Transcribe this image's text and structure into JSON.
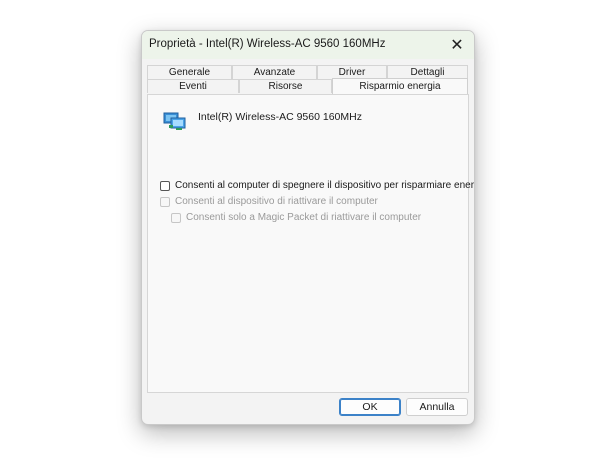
{
  "window": {
    "title": "Proprietà - Intel(R) Wireless-AC 9560 160MHz",
    "close_glyph": "✕"
  },
  "tabs": {
    "row1": [
      "Generale",
      "Avanzate",
      "Driver",
      "Dettagli"
    ],
    "row2": [
      "Eventi",
      "Risorse",
      "Risparmio energia"
    ],
    "active": "Risparmio energia"
  },
  "device": {
    "icon": "network-adapter-icon",
    "name": "Intel(R) Wireless-AC 9560 160MHz"
  },
  "options": [
    {
      "label": "Consenti al computer di spegnere il dispositivo per risparmiare energia",
      "checked": false,
      "enabled": true
    },
    {
      "label": "Consenti al dispositivo di riattivare il computer",
      "checked": false,
      "enabled": false
    },
    {
      "label": "Consenti solo a Magic Packet di riattivare il computer",
      "checked": false,
      "enabled": false
    }
  ],
  "buttons": {
    "ok": "OK",
    "cancel": "Annulla"
  },
  "colors": {
    "titlebar": "#edf4ea",
    "dialog_bg": "#f3f3f3",
    "accent_border": "#3c82c8",
    "disabled_text": "#9a9a9a"
  }
}
